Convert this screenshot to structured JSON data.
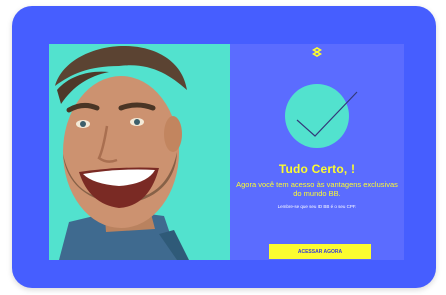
{
  "colors": {
    "frame": "#465eff",
    "panel": "#5b6cff",
    "accent_yellow": "#fcfc30",
    "accent_teal": "#52e2ce"
  },
  "icons": {
    "logo": "bb-logo-icon",
    "check": "check-icon"
  },
  "success": {
    "title": "Tudo Certo, !",
    "subtitle": "Agora você tem acesso às vantagens exclusivas do mundo BB.",
    "note": "Lembre-se que seu ID BB é o seu CPF."
  },
  "actions": {
    "cta_label": "ACESSAR AGORA"
  }
}
